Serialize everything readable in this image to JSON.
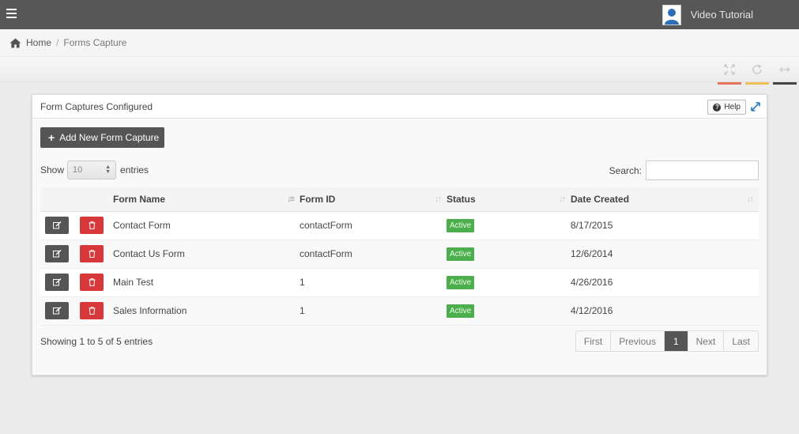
{
  "header": {
    "menu_icon": "hamburger-menu-icon",
    "user_label": "Video Tutorial",
    "avatar_icon": "user-avatar-icon"
  },
  "breadcrumb": {
    "home": "Home",
    "separator": "/",
    "current": "Forms Capture"
  },
  "toolbar": {
    "items": [
      {
        "icon": "fullscreen-icon",
        "accent": "#e8755a"
      },
      {
        "icon": "refresh-icon",
        "accent": "#f0c15a"
      },
      {
        "icon": "collapse-arrows-icon",
        "accent": "#444444"
      }
    ]
  },
  "panel": {
    "title": "Form Captures Configured",
    "help_label": "Help",
    "add_button": "Add New Form Capture",
    "show_label": "Show",
    "page_length": "10",
    "entries_label": "entries",
    "search_label": "Search:",
    "search_value": ""
  },
  "table": {
    "columns": [
      "",
      "Form Name",
      "Form ID",
      "Status",
      "Date Created"
    ],
    "rows": [
      {
        "name": "Contact Form",
        "form_id": "contactForm",
        "status": "Active",
        "date": "8/17/2015"
      },
      {
        "name": "Contact Us Form",
        "form_id": "contactForm",
        "status": "Active",
        "date": "12/6/2014"
      },
      {
        "name": "Main Test",
        "form_id": "1",
        "status": "Active",
        "date": "4/26/2016"
      },
      {
        "name": "Sales Information",
        "form_id": "1",
        "status": "Active",
        "date": "4/12/2016"
      }
    ]
  },
  "footer": {
    "info": "Showing 1 to 5 of 5 entries",
    "pager": {
      "first": "First",
      "previous": "Previous",
      "current": "1",
      "next": "Next",
      "last": "Last"
    }
  },
  "colors": {
    "topbar": "#575757",
    "delete": "#d9383a",
    "active_badge": "#4cae4c",
    "primary_button": "#555555"
  }
}
